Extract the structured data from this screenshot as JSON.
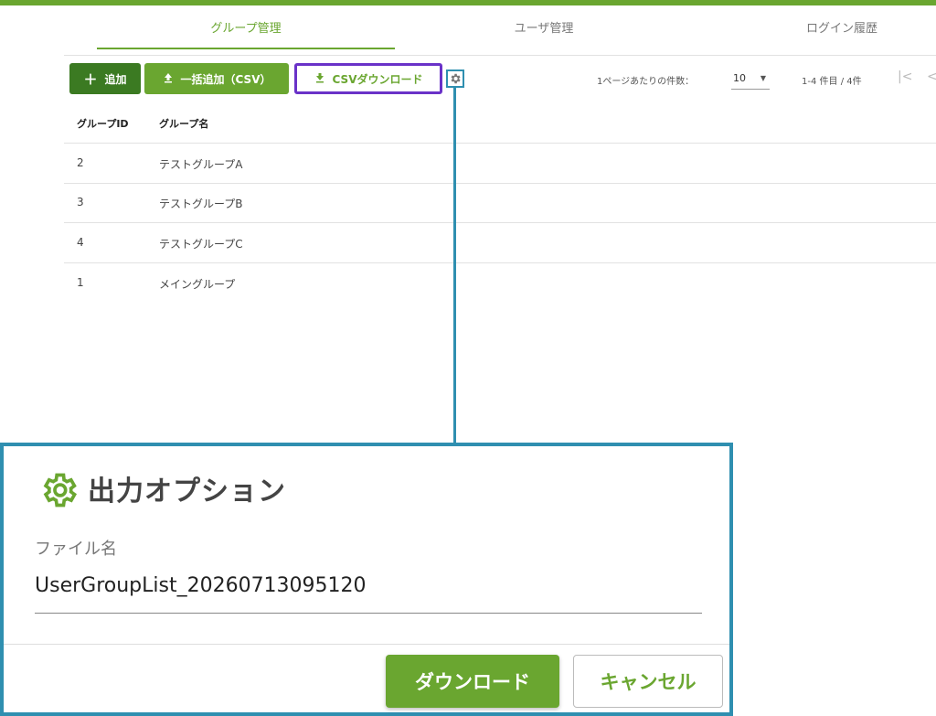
{
  "tabs": [
    {
      "label": "グループ管理",
      "active": true
    },
    {
      "label": "ユーザ管理",
      "active": false
    },
    {
      "label": "ログイン履歴",
      "active": false
    }
  ],
  "toolbar": {
    "add_label": "追加",
    "bulk_add_label": "一括追加（CSV）",
    "csv_download_label": "CSVダウンロード"
  },
  "pager": {
    "per_page_label": "1ページあたりの件数：",
    "per_page_value": "10",
    "range_label": "1-4 件目 / 4件",
    "first_icon": "|<",
    "prev_icon": "<"
  },
  "table": {
    "headers": [
      "グループID",
      "グループ名"
    ],
    "rows": [
      {
        "id": "2",
        "name": "テストグループA"
      },
      {
        "id": "3",
        "name": "テストグループB"
      },
      {
        "id": "4",
        "name": "テストグループC"
      },
      {
        "id": "1",
        "name": "メイングループ"
      }
    ]
  },
  "dialog": {
    "title": "出力オプション",
    "file_name_label": "ファイル名",
    "file_name_value": "UserGroupList_20260713095120",
    "download_label": "ダウンロード",
    "cancel_label": "キャンセル"
  },
  "colors": {
    "primary": "#6aa630",
    "primary_dark": "#3b7a22",
    "highlight_border": "#6a32c8",
    "callout": "#2f8fb0"
  }
}
